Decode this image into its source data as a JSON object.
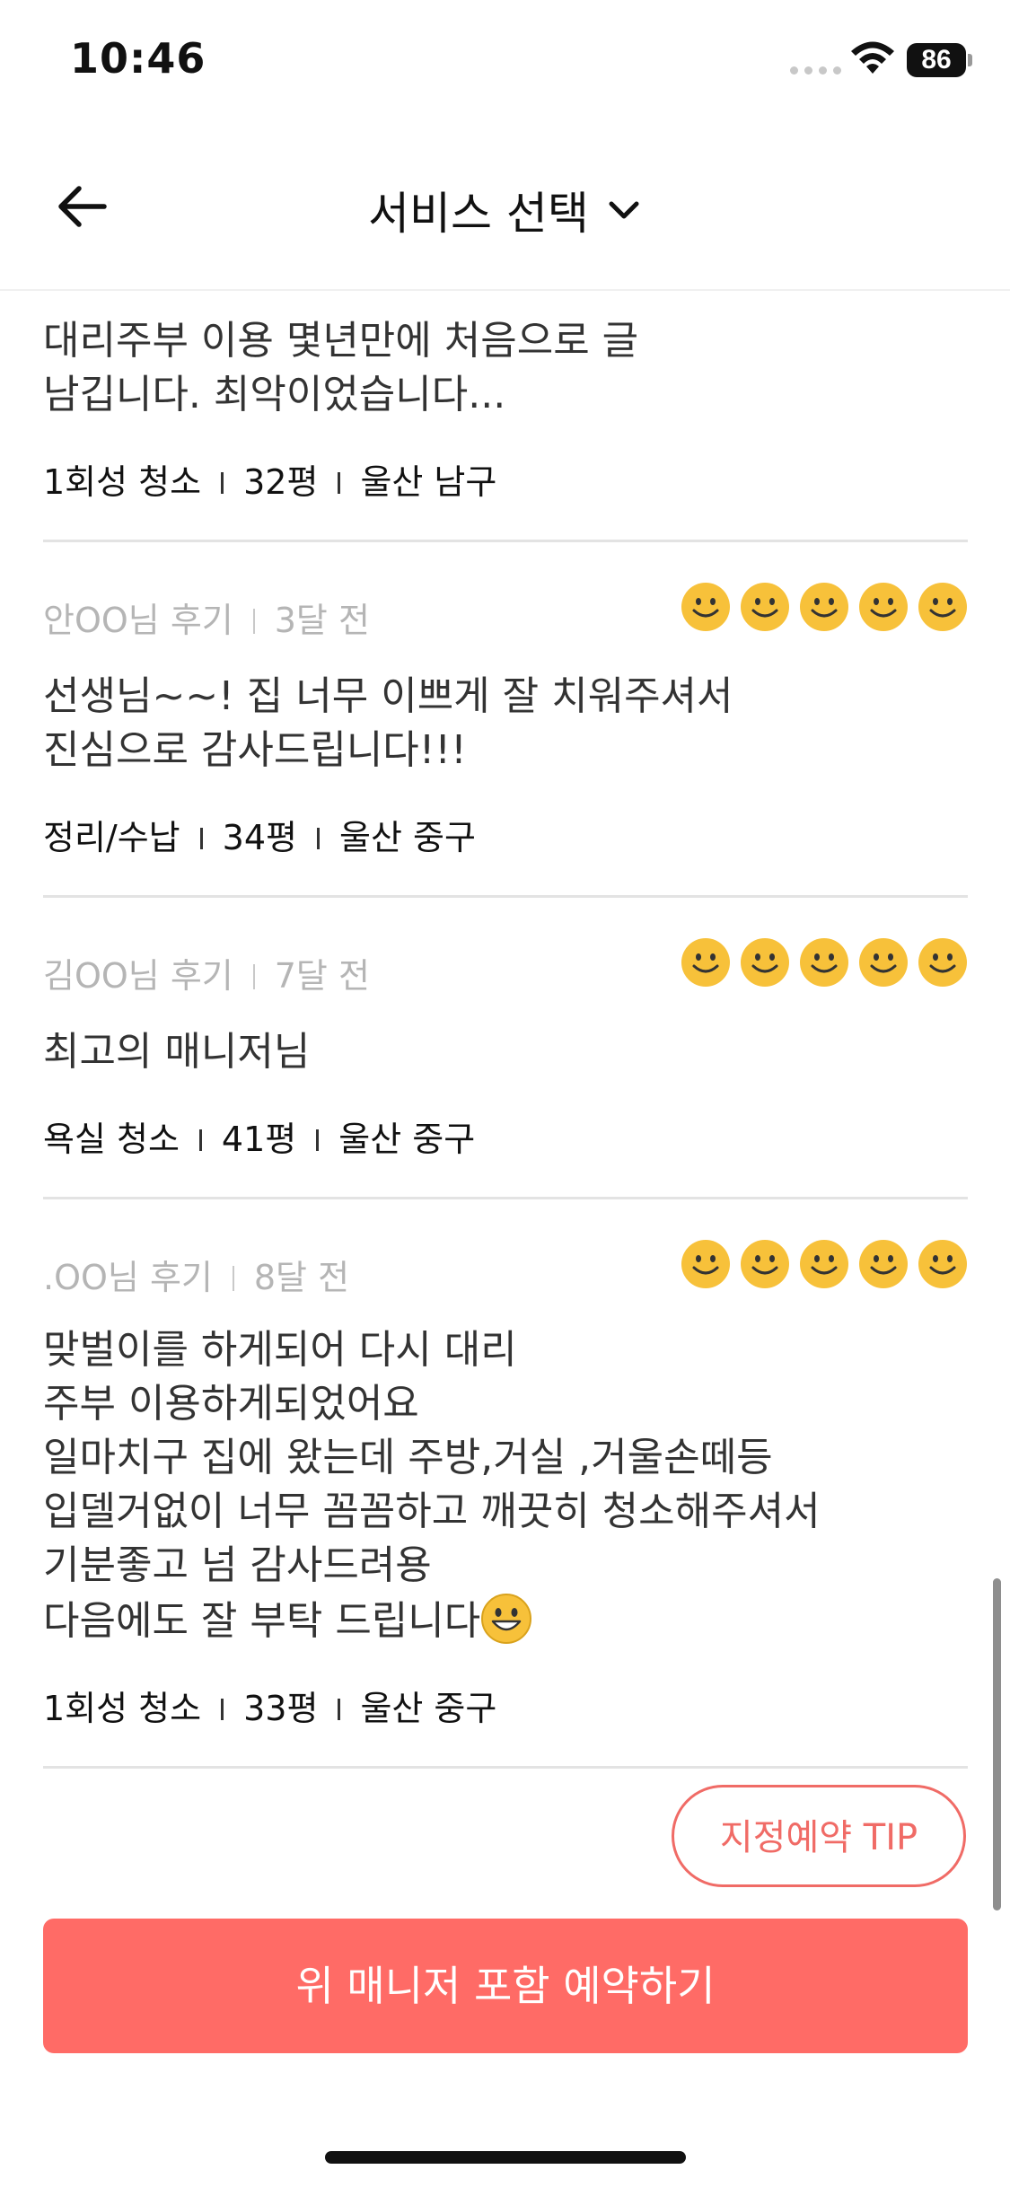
{
  "status_bar": {
    "time": "10:46",
    "battery": "86"
  },
  "header": {
    "title": "서비스 선택"
  },
  "reviews": [
    {
      "author": "",
      "time": "",
      "rating": 0,
      "body": "대리주부 이용 몇년만에 처음으로 글\n남깁니다. 최악이었습니다...",
      "service": "1회성 청소",
      "size": "32평",
      "location": "울산 남구"
    },
    {
      "author": "안OO님 후기",
      "time": "3달 전",
      "rating": 5,
      "body": "선생님~~! 집 너무 이쁘게 잘 치워주셔서\n진심으로 감사드립니다!!!",
      "service": "정리/수납",
      "size": "34평",
      "location": "울산 중구"
    },
    {
      "author": "김OO님 후기",
      "time": "7달 전",
      "rating": 5,
      "body": "최고의 매니저님",
      "service": "욕실 청소",
      "size": "41평",
      "location": "울산 중구"
    },
    {
      "author": ".OO님 후기",
      "time": "8달 전",
      "rating": 5,
      "body": "맞벌이를 하게되어 다시 대리\n주부 이용하게되었어요\n일마치구 집에 왔는데 주방,거실 ,거울손떼등\n입델거없이 너무 꼼꼼하고 깨끗히 청소해주셔서\n기분좋고 넘 감사드려용\n다음에도 잘 부탁 드립니다",
      "service": "1회성 청소",
      "size": "33평",
      "location": "울산 중구"
    }
  ],
  "tip_button": "지정예약 TIP",
  "cta_button": "위 매니저 포함 예약하기",
  "colors": {
    "accent": "#ff6b66",
    "smile": "#f7c13a"
  }
}
